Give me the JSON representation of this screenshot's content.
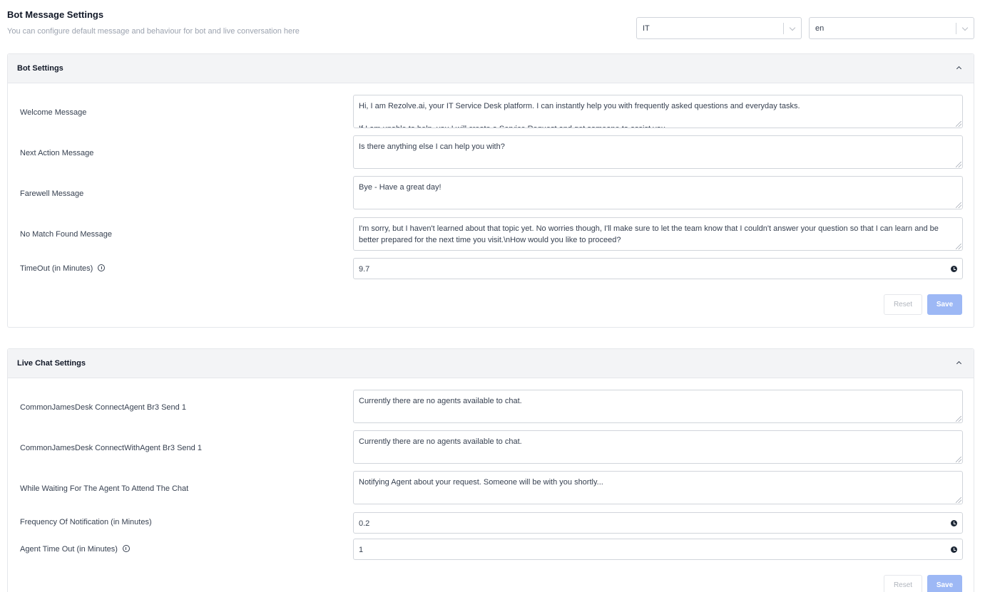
{
  "header": {
    "title": "Bot Message Settings",
    "subtitle": "You can configure default message and behaviour for bot and live conversation here"
  },
  "filters": {
    "department": "IT",
    "language": "en"
  },
  "bot_settings": {
    "title": "Bot Settings",
    "fields": [
      {
        "label": "Welcome Message",
        "value": "Hi, I am Rezolve.ai, your IT Service Desk platform. I can instantly help you with frequently asked questions and everyday tasks.\n\nIf I am unable to help, you I will create a Service Request and get someone to assist you."
      },
      {
        "label": "Next Action Message",
        "value": "Is there anything else I can help you with?"
      },
      {
        "label": "Farewell Message",
        "value": "Bye - Have a great day!"
      },
      {
        "label": "No Match Found Message",
        "value": "I'm sorry, but I haven't learned about that topic yet. No worries though, I'll make sure to let the team know that I couldn't answer your question so that I can learn and be better prepared for the next time you visit.\\nHow would you like to proceed?"
      }
    ],
    "timeout": {
      "label": "TimeOut (in Minutes)",
      "value": "9.7"
    },
    "reset_label": "Reset",
    "save_label": "Save"
  },
  "live_chat_settings": {
    "title": "Live Chat Settings",
    "fields": [
      {
        "label": "CommonJamesDesk ConnectAgent Br3 Send 1",
        "value": "Currently there are no agents available to chat."
      },
      {
        "label": "CommonJamesDesk ConnectWithAgent Br3 Send 1",
        "value": "Currently there are no agents available to chat."
      },
      {
        "label": "While Waiting For The Agent To Attend The Chat",
        "value": "Notifying Agent about your request. Someone will be with you shortly..."
      }
    ],
    "frequency": {
      "label": "Frequency Of Notification (in Minutes)",
      "value": "0.2"
    },
    "agent_timeout": {
      "label": "Agent Time Out (in Minutes)",
      "value": "1"
    },
    "reset_label": "Reset",
    "save_label": "Save"
  }
}
